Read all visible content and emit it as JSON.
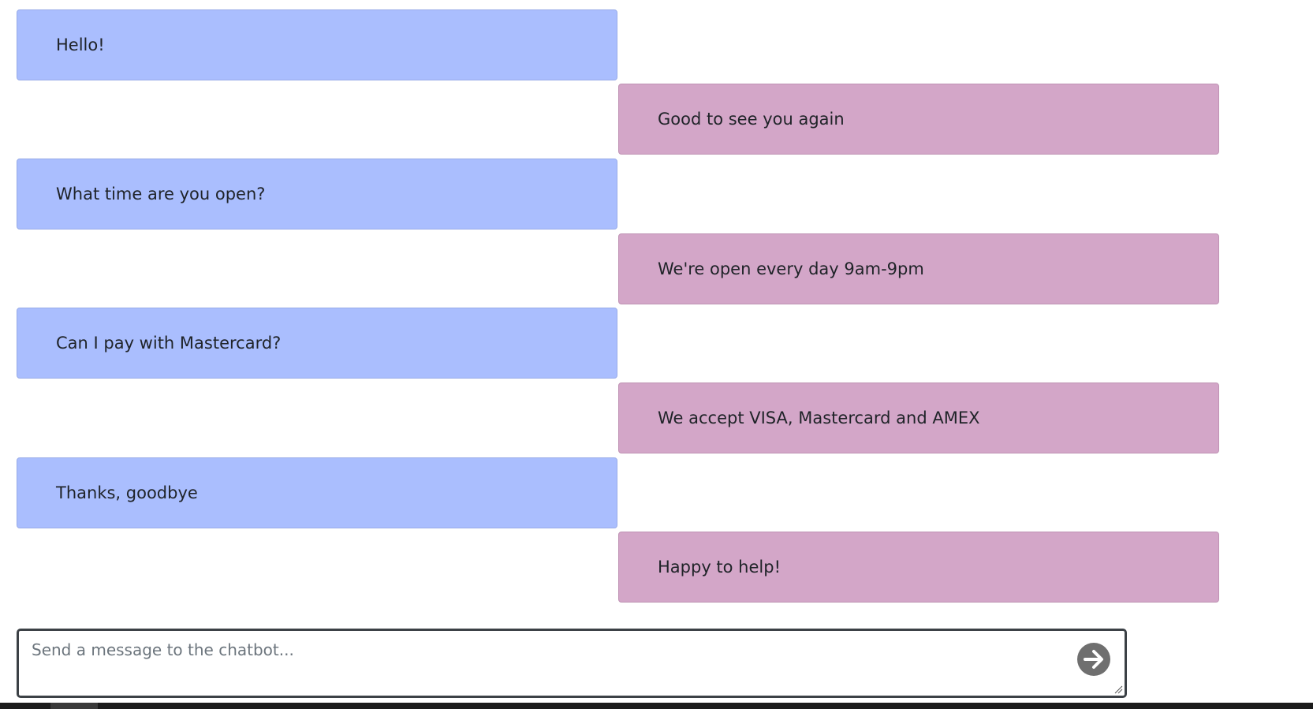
{
  "messages": [
    {
      "sender": "user",
      "text": "Hello!"
    },
    {
      "sender": "bot",
      "text": "Good to see you again"
    },
    {
      "sender": "user",
      "text": "What time are you open?"
    },
    {
      "sender": "bot",
      "text": "We're open every day 9am-9pm"
    },
    {
      "sender": "user",
      "text": "Can I pay with Mastercard?"
    },
    {
      "sender": "bot",
      "text": "We accept VISA, Mastercard and AMEX"
    },
    {
      "sender": "user",
      "text": "Thanks, goodbye"
    },
    {
      "sender": "bot",
      "text": "Happy to help!"
    }
  ],
  "composer": {
    "placeholder": "Send a message to the chatbot...",
    "value": "",
    "send_icon": "arrow-right-circle-icon"
  },
  "colors": {
    "user_bubble": "#aabefe",
    "bot_bubble": "#d3a6c8",
    "send_button": "#6f6f6f"
  }
}
